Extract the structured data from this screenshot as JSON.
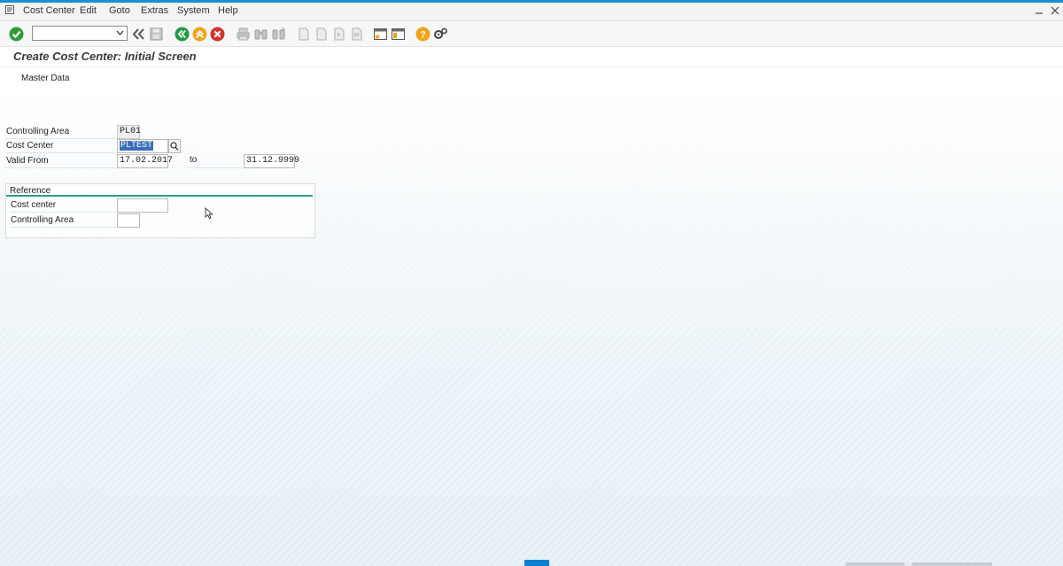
{
  "menubar": {
    "items": [
      "Cost Center",
      "Edit",
      "Goto",
      "Extras",
      "System",
      "Help"
    ]
  },
  "toolbar": {
    "command_field_value": ""
  },
  "title": "Create Cost Center: Initial Screen",
  "app_toolbar": {
    "master_data_label": "Master Data"
  },
  "form": {
    "controlling_area_label": "Controlling Area",
    "controlling_area_value": "PL01",
    "cost_center_label": "Cost Center",
    "cost_center_value": "PLTEST",
    "valid_from_label": "Valid From",
    "valid_from_value": "17.02.2017",
    "to_label": "to",
    "valid_to_value": "31.12.9999"
  },
  "reference": {
    "title": "Reference",
    "cost_center_label": "Cost center",
    "cost_center_value": "",
    "controlling_area_label": "Controlling Area",
    "controlling_area_value": ""
  },
  "colors": {
    "accent": "#1b8fd6",
    "group_line": "#2a9c8f",
    "selection": "#3b6fb6"
  },
  "icons": {
    "enter": "checkmark-icon",
    "back": "back-icon",
    "exit": "exit-icon",
    "cancel": "cancel-icon",
    "help": "help-icon",
    "settings": "gear-icon"
  }
}
